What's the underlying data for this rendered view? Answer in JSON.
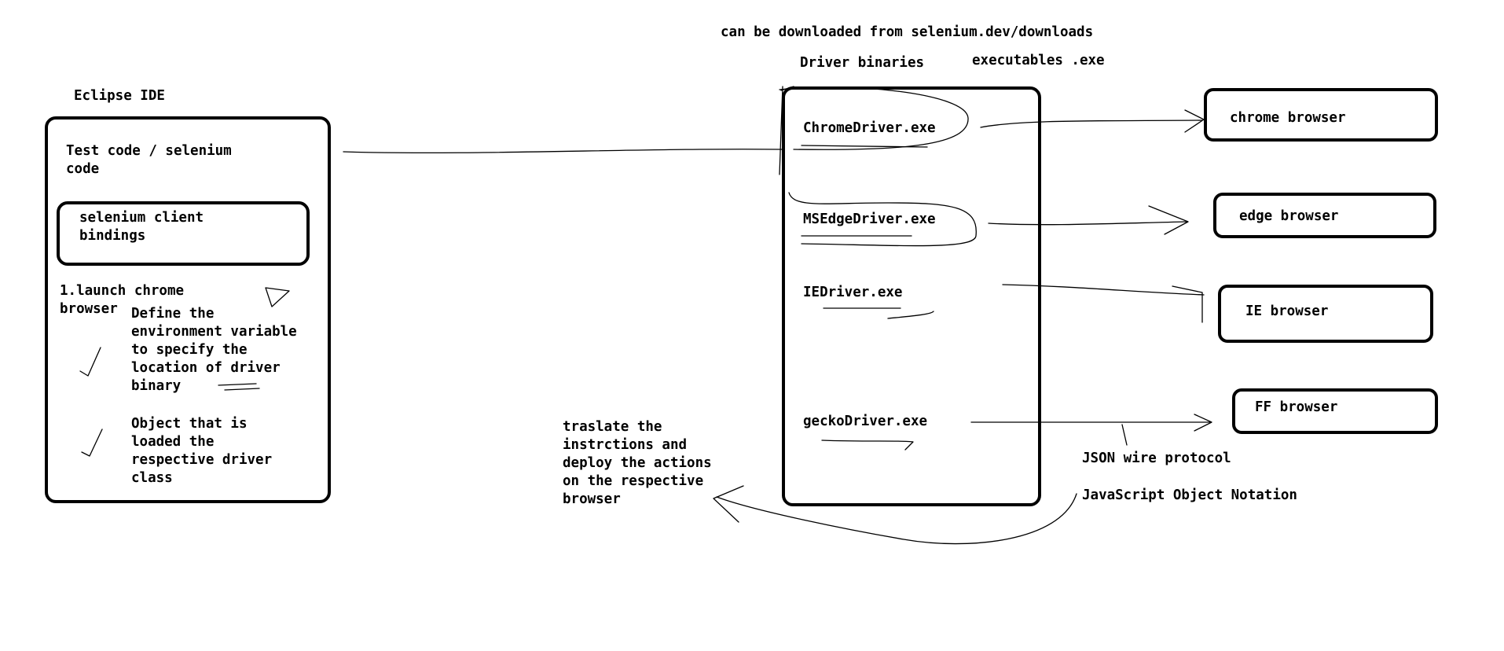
{
  "header": {
    "download_note": "can be downloaded from selenium.dev/downloads",
    "driver_binaries_label": "Driver binaries",
    "executables_label": "executables .exe"
  },
  "eclipse": {
    "title": "Eclipse IDE",
    "test_code": "Test code / selenium\ncode",
    "client_bindings": "selenium client\nbindings",
    "step_launch": "1.launch chrome\nbrowser",
    "env_variable_note": "Define the\nenvironment variable\nto specify the\nlocation of driver\nbinary",
    "object_note": "Object that is\nloaded the\nrespective driver\nclass"
  },
  "drivers": [
    "ChromeDriver.exe",
    "MSEdgeDriver.exe",
    "IEDriver.exe",
    "geckoDriver.exe"
  ],
  "browsers": [
    "chrome browser",
    "edge browser",
    "IE browser",
    "FF browser"
  ],
  "protocol": {
    "name": "JSON wire protocol",
    "expansion": "JavaScript Object Notation"
  },
  "translate_note": "traslate the\ninstrctions and\ndeploy the actions\non the respective\nbrowser"
}
